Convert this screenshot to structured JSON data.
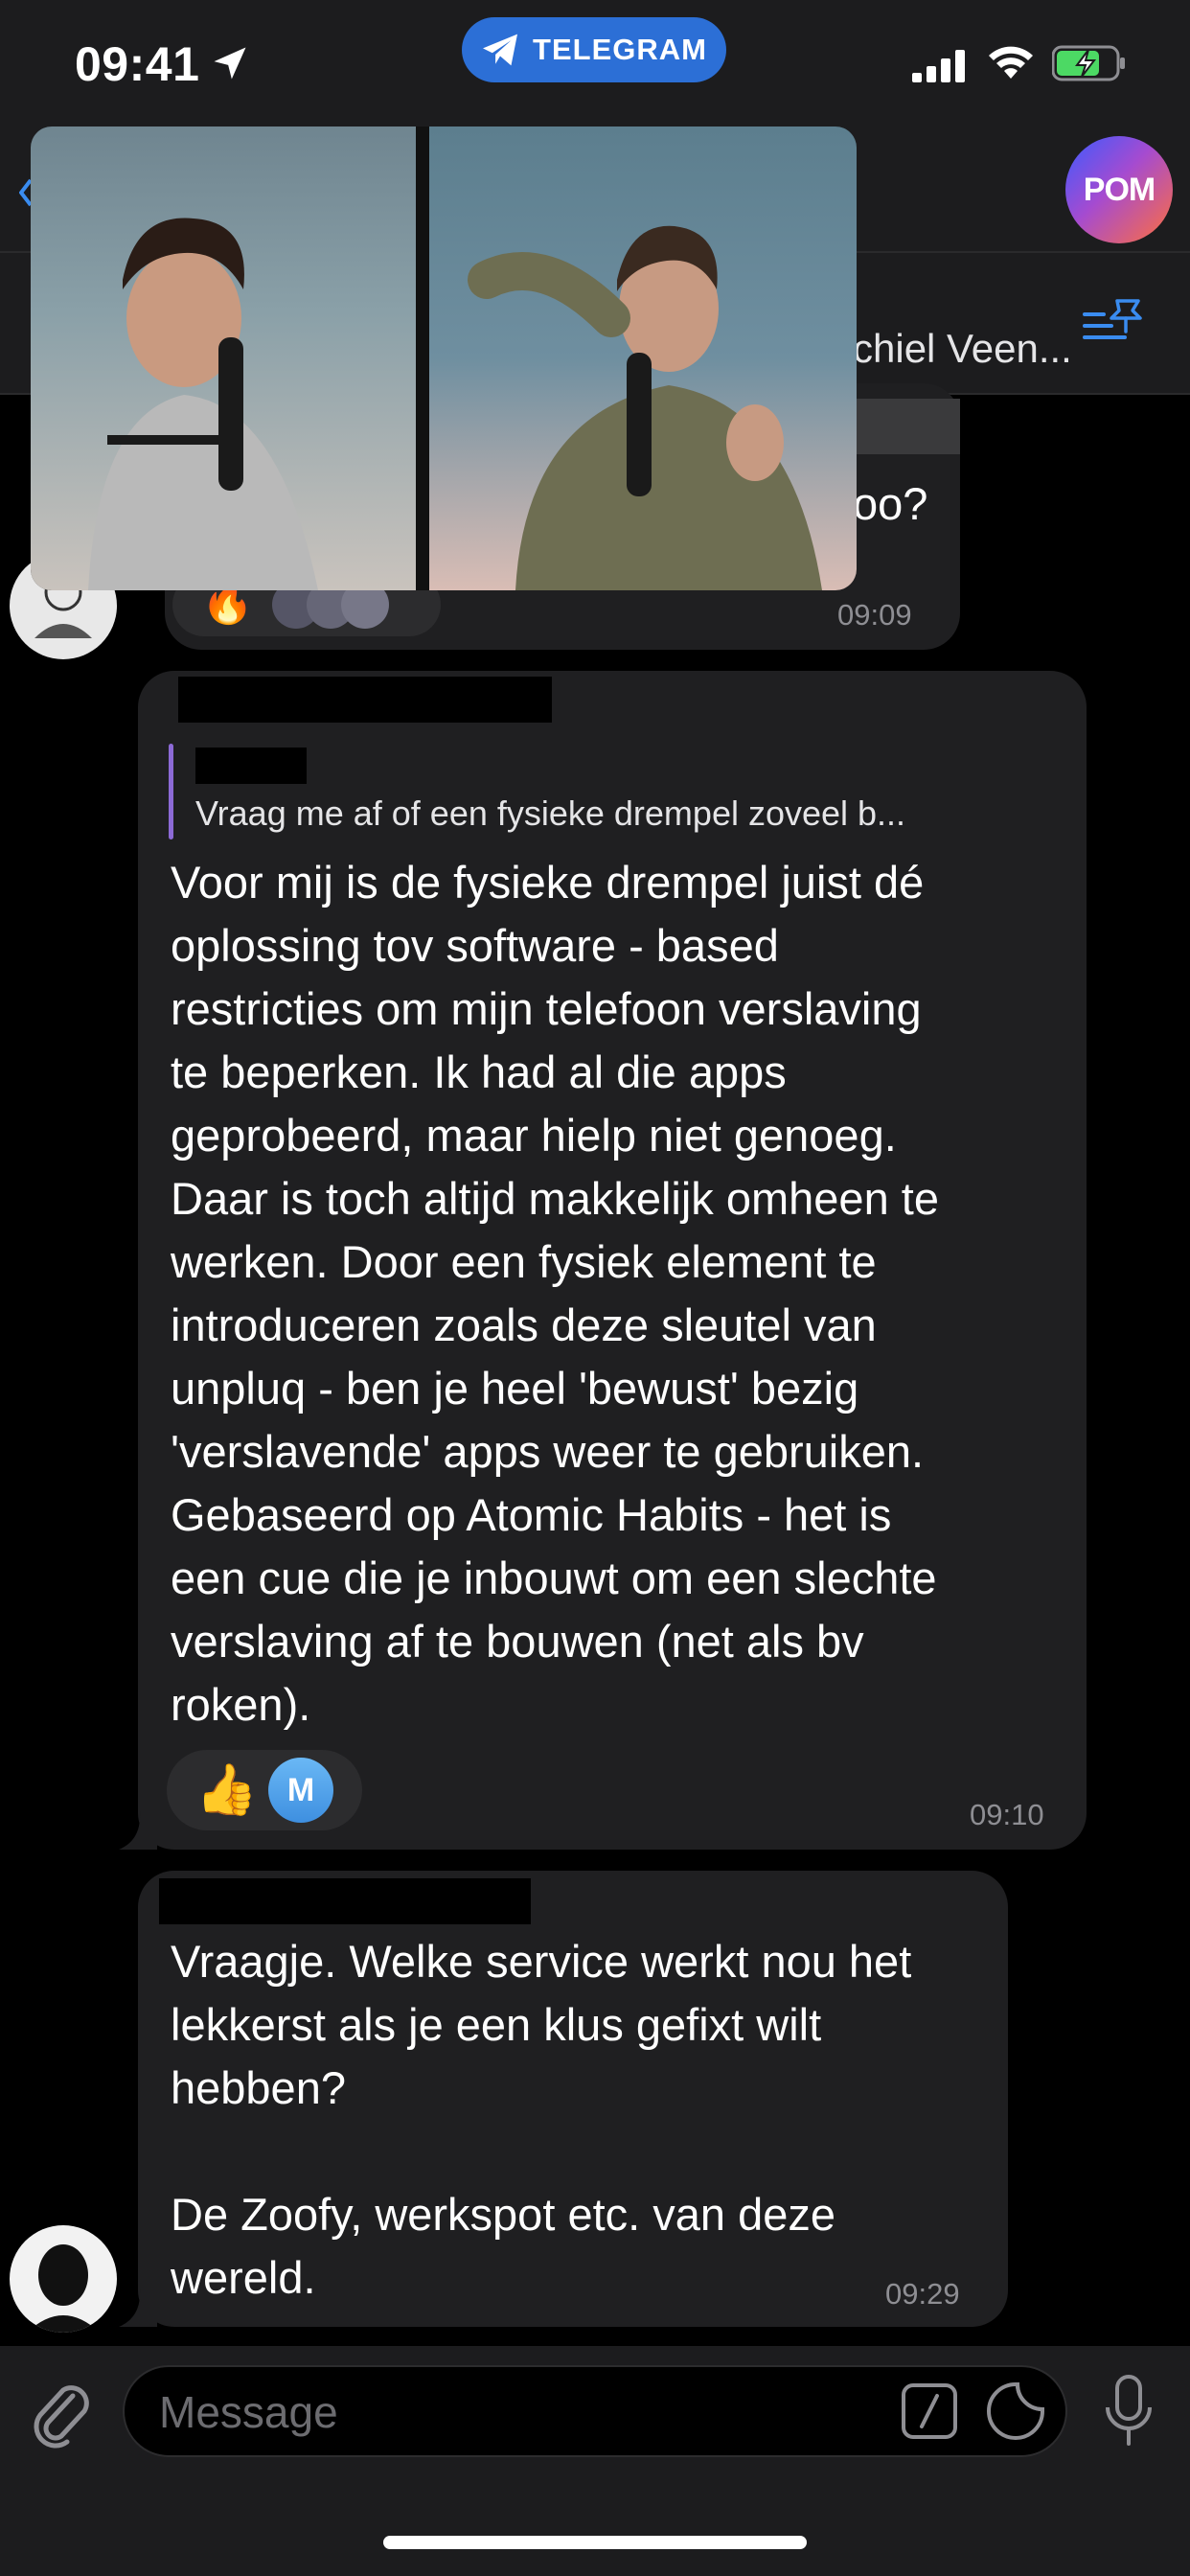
{
  "status_bar": {
    "time": "09:41",
    "app_pill": "TELEGRAM"
  },
  "header": {
    "channel_avatar_text": "POM",
    "pinned_name": "chiel Veen..."
  },
  "messages": [
    {
      "partial_text": "oo?",
      "time": "09:09",
      "reaction": "🔥"
    },
    {
      "reply_preview": "Vraag me af of een fysieke drempel zoveel b...",
      "text": "Voor mij is de fysieke drempel juist dé\noplossing tov software - based\nrestricties om mijn telefoon verslaving\nte beperken. Ik had al die apps\ngeprobeerd, maar hielp niet genoeg.\nDaar is toch altijd makkelijk omheen te\nwerken. Door een fysiek element te\nintroduceren zoals deze sleutel van\nunpluq - ben je heel 'bewust' bezig\n'verslavende' apps weer te gebruiken.\nGebaseerd op Atomic Habits - het is\neen cue die je inbouwt om een slechte\nverslaving af te bouwen (net als bv\nroken).",
      "reaction": "👍",
      "reactor_initial": "M",
      "time": "09:10"
    },
    {
      "text": "Vraagje. Welke service werkt nou het\nlekkerst als je een klus gefixt wilt\nhebben?\n\nDe Zoofy, werkspot etc. van deze\nwereld.",
      "time": "09:29"
    }
  ],
  "input": {
    "placeholder": "Message"
  },
  "colors": {
    "accent": "#2c6fd6",
    "bubble": "#1f1f21",
    "reply_bar": "#8c6ad6"
  }
}
